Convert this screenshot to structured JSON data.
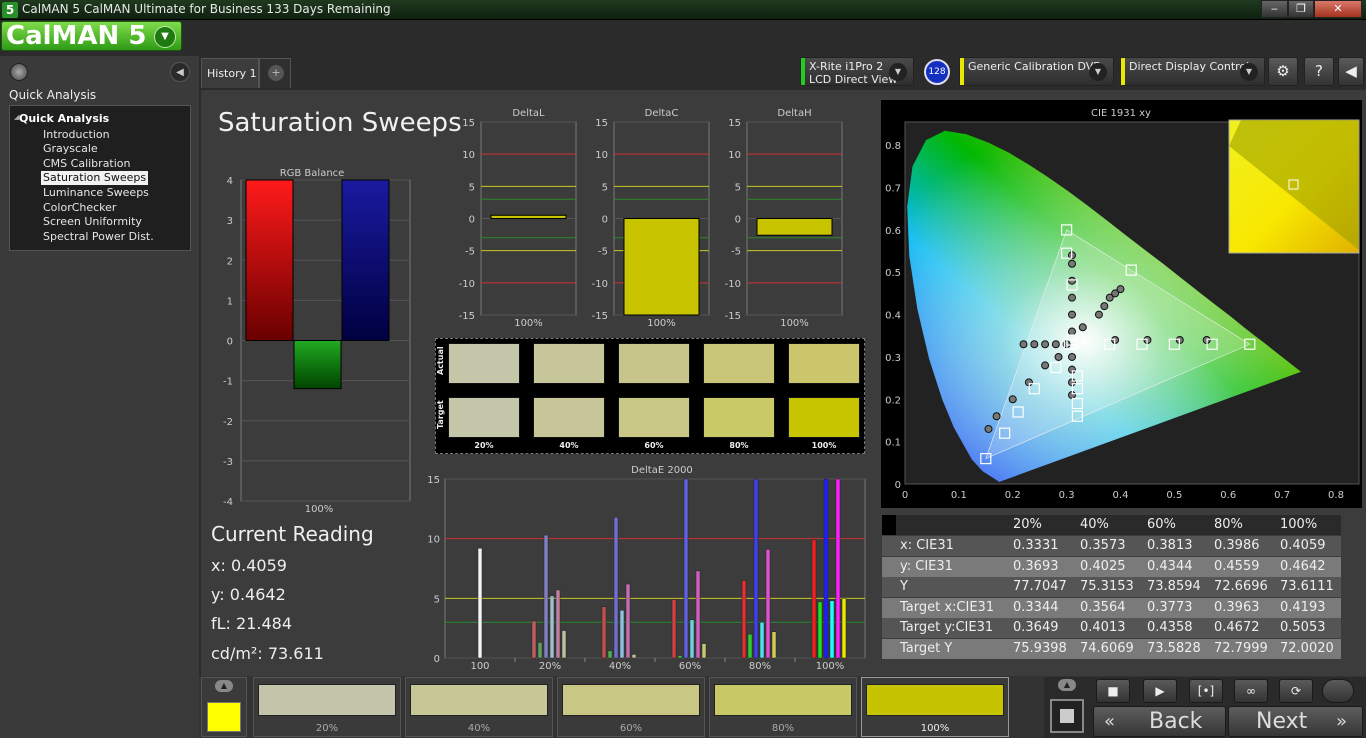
{
  "window": {
    "title": "CalMAN 5 CalMAN Ultimate for Business 133 Days Remaining",
    "icon_glyph": "5",
    "buttons": [
      "‒",
      "❐",
      "✕"
    ]
  },
  "logo": {
    "text": "CalMAN 5"
  },
  "sidebar": {
    "heading": "Quick Analysis",
    "tree_root": "Quick Analysis",
    "items": [
      "Introduction",
      "Grayscale",
      "CMS Calibration",
      "Saturation Sweeps",
      "Luminance Sweeps",
      "ColorChecker",
      "Screen Uniformity",
      "Spectral Power Dist."
    ],
    "selected_index": 3
  },
  "tabs": {
    "history": "History 1",
    "add": "+"
  },
  "devices": {
    "meter": {
      "line1": "X-Rite i1Pro 2",
      "line2": "LCD Direct View",
      "badge": "128",
      "color": "#22cc22"
    },
    "source": {
      "line1": "Generic Calibration DVD",
      "color": "#e8e800"
    },
    "display": {
      "line1": "Direct Display Control",
      "color": "#e8e800"
    }
  },
  "toolbar": {
    "settings": "⚙",
    "help": "?",
    "collapse": "◀"
  },
  "page_title": "Saturation Sweeps",
  "current_reading": {
    "title": "Current Reading",
    "x": "x: 0.4059",
    "y": "y: 0.4642",
    "fl": "fL: 21.484",
    "cd": "cd/m²: 73.611"
  },
  "patch_labels": {
    "actual": "Actual",
    "target": "Target"
  },
  "levels": [
    "20%",
    "40%",
    "60%",
    "80%",
    "100%"
  ],
  "actual_colors": [
    "#c4c6aa",
    "#c6c69a",
    "#c8c58a",
    "#c9c67a",
    "#cbc56c"
  ],
  "target_colors": [
    "#c3c6a9",
    "#c6c699",
    "#c9c785",
    "#cac968",
    "#c7c400"
  ],
  "thumb_colors": [
    "#c3c5aa",
    "#c6c696",
    "#c8c783",
    "#c8c864",
    "#c6c400"
  ],
  "current_swatch": "#ffff00",
  "chart_data": [
    {
      "type": "bar",
      "title": "RGB Balance",
      "categories": [
        "100%"
      ],
      "series": [
        {
          "values": [
            4
          ],
          "color": "#cc0000"
        },
        {
          "values": [
            -1.2
          ],
          "color": "#008800"
        },
        {
          "values": [
            4
          ],
          "color": "#000088"
        }
      ],
      "ylim": [
        -4,
        4
      ],
      "yticks": [
        -4,
        -3,
        -2,
        -1,
        0,
        1,
        2,
        3,
        4
      ]
    },
    {
      "type": "bar",
      "title": "DeltaL",
      "categories": [
        "100%"
      ],
      "values": [
        0.5
      ],
      "ylim": [
        -15,
        15
      ],
      "yticks": [
        15,
        10,
        5,
        0,
        -5,
        -10,
        -15
      ]
    },
    {
      "type": "bar",
      "title": "DeltaC",
      "categories": [
        "100%"
      ],
      "values": [
        -15
      ],
      "ylim": [
        -15,
        15
      ],
      "yticks": [
        15,
        10,
        5,
        0,
        -5,
        -10,
        -15
      ]
    },
    {
      "type": "bar",
      "title": "DeltaH",
      "categories": [
        "100%"
      ],
      "values": [
        -2.6
      ],
      "ylim": [
        -15,
        15
      ],
      "yticks": [
        15,
        10,
        5,
        0,
        -5,
        -10,
        -15
      ]
    },
    {
      "type": "bar",
      "title": "DeltaE 2000",
      "categories": [
        "100",
        "20%",
        "40%",
        "60%",
        "80%",
        "100%"
      ],
      "ylim": [
        0,
        15
      ],
      "yticks": [
        0,
        5,
        10,
        15
      ],
      "groups": [
        [
          9.2
        ],
        [
          3.1,
          1.3,
          10.3,
          5.2,
          5.7,
          2.3
        ],
        [
          4.3,
          0.6,
          11.8,
          4.0,
          6.2,
          0.3
        ],
        [
          4.9,
          0.2,
          15,
          3.2,
          7.3,
          1.2
        ],
        [
          6.5,
          2.0,
          15,
          3.0,
          9.1,
          2.2
        ],
        [
          9.9,
          4.7,
          15,
          4.8,
          15,
          5.0
        ]
      ]
    },
    {
      "type": "scatter",
      "title": "CIE 1931 xy",
      "xlim": [
        0,
        0.8
      ],
      "ylim": [
        0,
        0.85
      ],
      "xticks": [
        0,
        0.1,
        0.2,
        0.3,
        0.4,
        0.5,
        0.6,
        0.7,
        0.8
      ],
      "yticks": [
        0,
        0.1,
        0.2,
        0.3,
        0.4,
        0.5,
        0.6,
        0.7,
        0.8
      ],
      "gamut": [
        [
          0.64,
          0.33
        ],
        [
          0.3,
          0.6
        ],
        [
          0.15,
          0.06
        ]
      ],
      "targets": [
        [
          0.15,
          0.06
        ],
        [
          0.185,
          0.12
        ],
        [
          0.21,
          0.17
        ],
        [
          0.24,
          0.225
        ],
        [
          0.28,
          0.275
        ],
        [
          0.305,
          0.33
        ],
        [
          0.3,
          0.6
        ],
        [
          0.3,
          0.545
        ],
        [
          0.31,
          0.47
        ],
        [
          0.31,
          0.34
        ],
        [
          0.32,
          0.16
        ],
        [
          0.32,
          0.19
        ],
        [
          0.32,
          0.225
        ],
        [
          0.32,
          0.255
        ],
        [
          0.42,
          0.505
        ],
        [
          0.38,
          0.33
        ],
        [
          0.44,
          0.33
        ],
        [
          0.5,
          0.33
        ],
        [
          0.57,
          0.33
        ],
        [
          0.64,
          0.33
        ],
        [
          0.31,
          0.33
        ]
      ],
      "measured": [
        [
          0.155,
          0.13
        ],
        [
          0.17,
          0.16
        ],
        [
          0.2,
          0.2
        ],
        [
          0.23,
          0.24
        ],
        [
          0.26,
          0.28
        ],
        [
          0.285,
          0.3
        ],
        [
          0.31,
          0.54
        ],
        [
          0.31,
          0.52
        ],
        [
          0.31,
          0.48
        ],
        [
          0.31,
          0.44
        ],
        [
          0.31,
          0.4
        ],
        [
          0.31,
          0.36
        ],
        [
          0.31,
          0.3
        ],
        [
          0.31,
          0.27
        ],
        [
          0.31,
          0.24
        ],
        [
          0.31,
          0.21
        ],
        [
          0.33,
          0.37
        ],
        [
          0.36,
          0.4
        ],
        [
          0.38,
          0.44
        ],
        [
          0.4,
          0.46
        ],
        [
          0.39,
          0.45
        ],
        [
          0.37,
          0.42
        ],
        [
          0.39,
          0.34
        ],
        [
          0.45,
          0.34
        ],
        [
          0.51,
          0.34
        ],
        [
          0.56,
          0.34
        ],
        [
          0.22,
          0.33
        ],
        [
          0.24,
          0.33
        ],
        [
          0.26,
          0.33
        ],
        [
          0.28,
          0.33
        ],
        [
          0.3,
          0.33
        ]
      ]
    }
  ],
  "table": {
    "headers": [
      "20%",
      "40%",
      "60%",
      "80%",
      "100%"
    ],
    "rows": [
      {
        "label": "x: CIE31",
        "values": [
          "0.3331",
          "0.3573",
          "0.3813",
          "0.3986",
          "0.4059"
        ]
      },
      {
        "label": "y: CIE31",
        "values": [
          "0.3693",
          "0.4025",
          "0.4344",
          "0.4559",
          "0.4642"
        ]
      },
      {
        "label": "Y",
        "values": [
          "77.7047",
          "75.3153",
          "73.8594",
          "72.6696",
          "73.6111"
        ]
      },
      {
        "label": "Target x:CIE31",
        "values": [
          "0.3344",
          "0.3564",
          "0.3773",
          "0.3963",
          "0.4193"
        ]
      },
      {
        "label": "Target y:CIE31",
        "values": [
          "0.3649",
          "0.4013",
          "0.4358",
          "0.4672",
          "0.5053"
        ]
      },
      {
        "label": "Target Y",
        "values": [
          "75.9398",
          "74.6069",
          "73.5828",
          "72.7999",
          "72.0020"
        ]
      }
    ]
  },
  "controls": {
    "stop": "■",
    "play": "▶",
    "bracket": "[•]",
    "loop": "∞",
    "refresh": "⟳",
    "back": "Back",
    "next": "Next",
    "back_arrow": "«",
    "next_arrow": "»",
    "up": "▲"
  }
}
